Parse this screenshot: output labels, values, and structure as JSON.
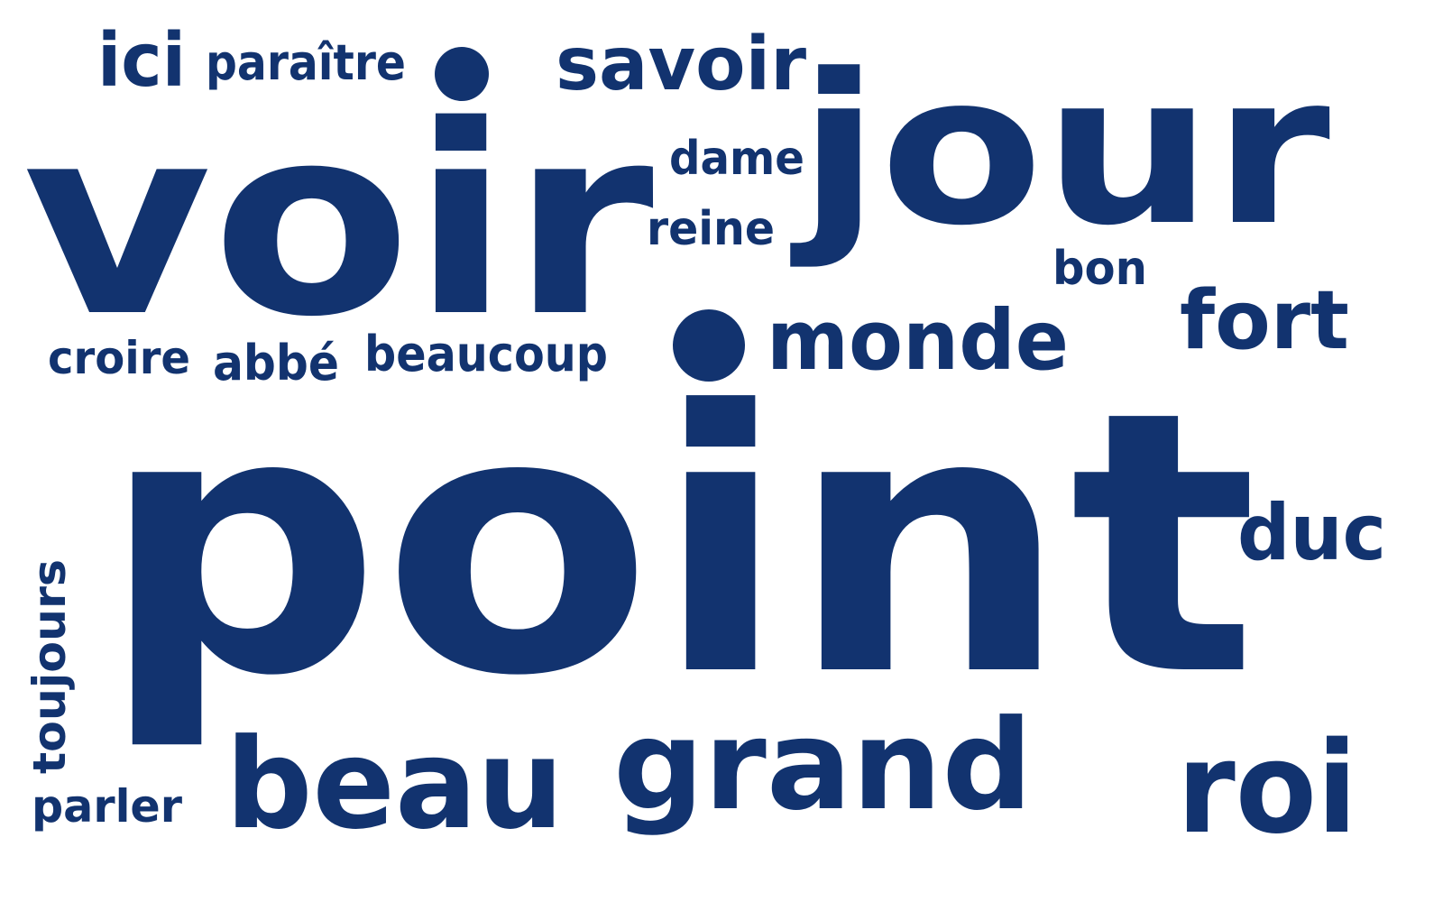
{
  "cloud": {
    "color": "#12336f",
    "words": {
      "point": "point",
      "voir": "voir",
      "jour": "jour",
      "grand": "grand",
      "beau": "beau",
      "roi": "roi",
      "monde": "monde",
      "fort": "fort",
      "savoir": "savoir",
      "duc": "duc",
      "ici": "ici",
      "paraitre": "paraître",
      "dame": "dame",
      "reine": "reine",
      "bon": "bon",
      "croire": "croire",
      "abbe": "abbé",
      "beaucoup": "beaucoup",
      "toujours": "toujours",
      "parler": "parler"
    },
    "bullet_glyph": "•"
  }
}
